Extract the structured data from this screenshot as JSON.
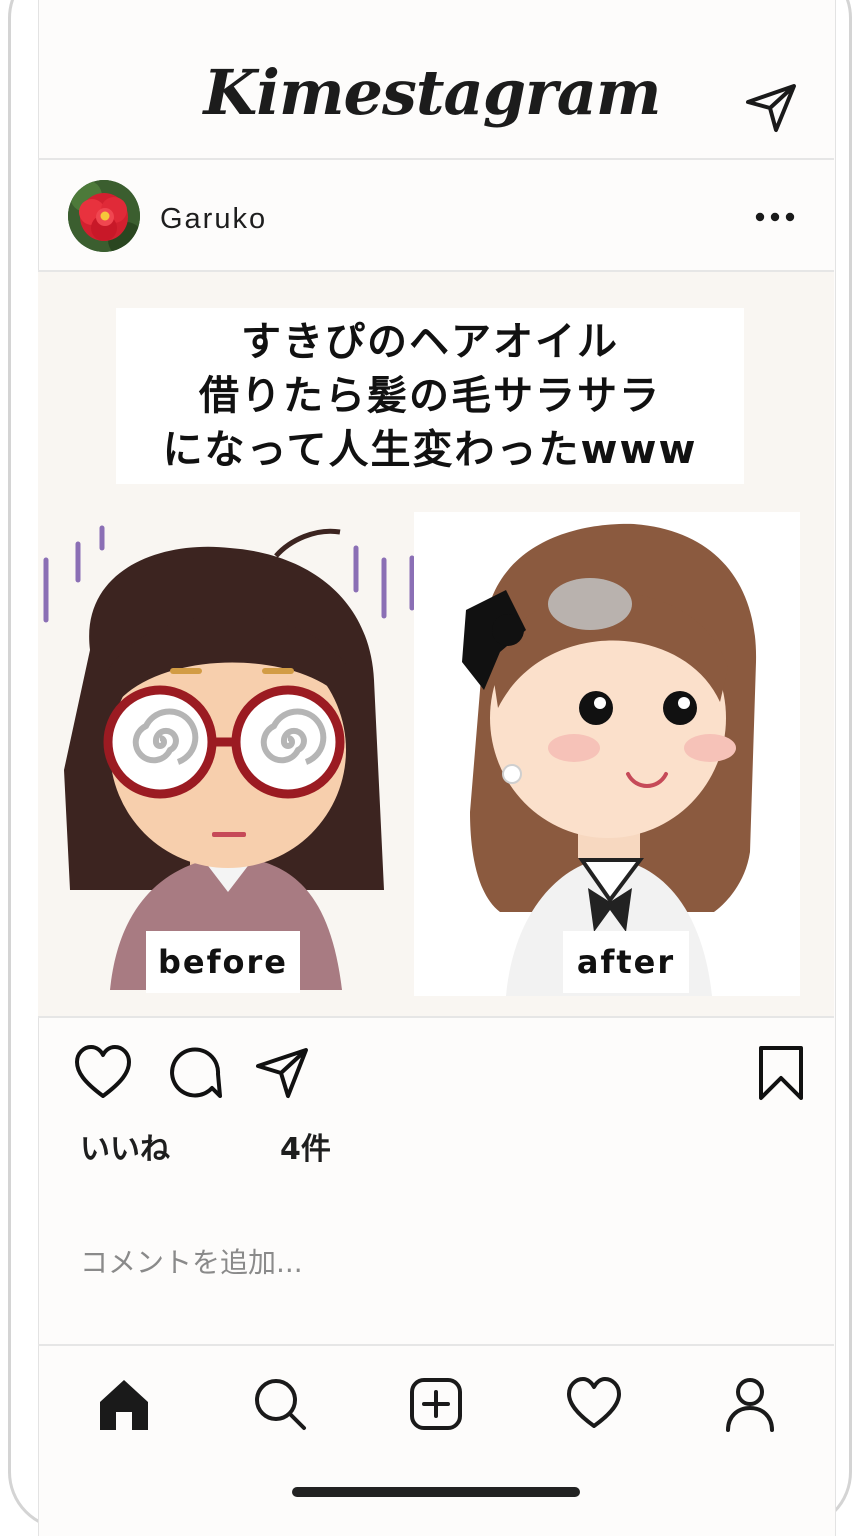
{
  "app": {
    "title": "Kimestagram"
  },
  "post": {
    "username": "Garuko",
    "caption_lines": [
      "すきぴのヘアオイル",
      "借りたら髪の毛サラサラ",
      "になって人生変わったwww"
    ],
    "labels": {
      "before": "before",
      "after": "after"
    }
  },
  "likes": {
    "label": "いいね",
    "count": "4件"
  },
  "comment": {
    "placeholder": "コメントを追加..."
  },
  "icons": {
    "top": "send-icon",
    "post_header": "more-icon",
    "actions": [
      "heart-icon",
      "comment-icon",
      "send-icon",
      "bookmark-icon"
    ],
    "nav": [
      "home-icon",
      "search-icon",
      "add-post-icon",
      "activity-heart-icon",
      "profile-icon"
    ]
  },
  "colors": {
    "text": "#1c1c1c",
    "divider": "#e6e6e6",
    "placeholder": "#8a8a8a",
    "post_background": "#f9f6f2"
  }
}
